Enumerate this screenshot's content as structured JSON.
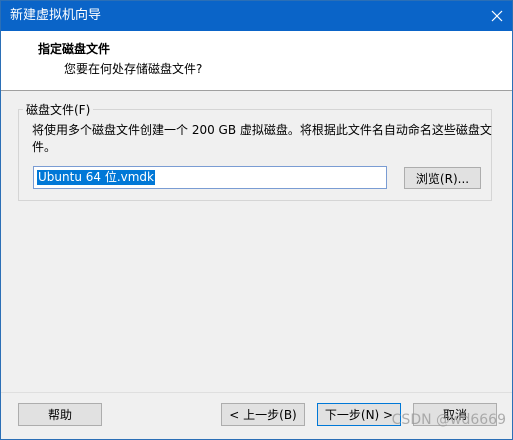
{
  "window": {
    "title": "新建虚拟机向导",
    "close_icon": "close-icon"
  },
  "header": {
    "title": "指定磁盘文件",
    "subtitle": "您要在何处存储磁盘文件?"
  },
  "disk_file_group": {
    "label": "磁盘文件(F)",
    "description": "将使用多个磁盘文件创建一个 200 GB 虚拟磁盘。将根据此文件名自动命名这些磁盘文件。",
    "file_name_value": "Ubuntu 64 位.vmdk",
    "browse_label": "浏览(R)..."
  },
  "footer": {
    "help_label": "帮助",
    "back_label": "< 上一步(B)",
    "next_label": "下一步(N) >",
    "cancel_label": "取消"
  },
  "watermark": "CSDN @wd6669",
  "colors": {
    "titlebar": "#0a64c8",
    "selection": "#0078d7",
    "default_button_border": "#0078d7"
  }
}
